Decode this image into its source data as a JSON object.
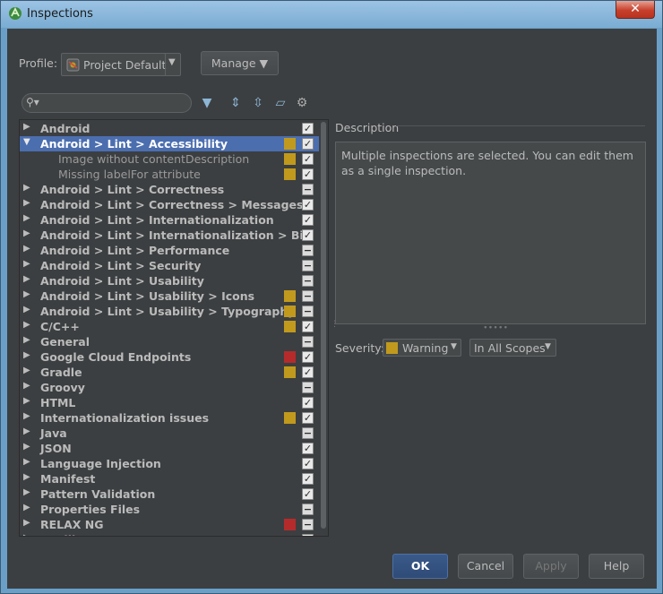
{
  "window": {
    "title": "Inspections",
    "close_glyph": "✕"
  },
  "profile": {
    "label": "Profile:",
    "value": "Project Default",
    "arrow": "▼"
  },
  "manage": {
    "label": "Manage ▼"
  },
  "search": {
    "icon": "search-icon",
    "placeholder": ""
  },
  "toolbar": {
    "filter": "filter-icon",
    "expand": "expand-all-icon",
    "collapse": "collapse-all-icon",
    "reset": "reset-icon",
    "settings": "gear-icon"
  },
  "colors": {
    "warning": "#c19a1d",
    "error": "#b52b2b",
    "selection": "#4b6eaf"
  },
  "tree": {
    "items": [
      {
        "label": "Android",
        "arrow": "▶",
        "severity": "",
        "check": "✓"
      },
      {
        "label": "Android > Lint > Accessibility",
        "arrow": "▼",
        "severity": "warning",
        "check": "✓",
        "selected": true
      },
      {
        "label": "Image without contentDescription",
        "arrow": "",
        "severity": "warning",
        "check": "✓",
        "child": true
      },
      {
        "label": "Missing labelFor attribute",
        "arrow": "",
        "severity": "warning",
        "check": "✓",
        "child": true
      },
      {
        "label": "Android > Lint > Correctness",
        "arrow": "▶",
        "severity": "",
        "check": "−"
      },
      {
        "label": "Android > Lint > Correctness > Messages",
        "arrow": "▶",
        "severity": "",
        "check": "✓"
      },
      {
        "label": "Android > Lint > Internationalization",
        "arrow": "▶",
        "severity": "",
        "check": "✓"
      },
      {
        "label": "Android > Lint > Internationalization > Bid",
        "arrow": "▶",
        "severity": "",
        "check": "✓"
      },
      {
        "label": "Android > Lint > Performance",
        "arrow": "▶",
        "severity": "",
        "check": "−"
      },
      {
        "label": "Android > Lint > Security",
        "arrow": "▶",
        "severity": "",
        "check": "−"
      },
      {
        "label": "Android > Lint > Usability",
        "arrow": "▶",
        "severity": "",
        "check": "−"
      },
      {
        "label": "Android > Lint > Usability > Icons",
        "arrow": "▶",
        "severity": "warning",
        "check": "−"
      },
      {
        "label": "Android > Lint > Usability > Typography",
        "arrow": "▶",
        "severity": "warning",
        "check": "−"
      },
      {
        "label": "C/C++",
        "arrow": "▶",
        "severity": "warning",
        "check": "✓"
      },
      {
        "label": "General",
        "arrow": "▶",
        "severity": "",
        "check": "−"
      },
      {
        "label": "Google Cloud Endpoints",
        "arrow": "▶",
        "severity": "error",
        "check": "✓"
      },
      {
        "label": "Gradle",
        "arrow": "▶",
        "severity": "warning",
        "check": "✓"
      },
      {
        "label": "Groovy",
        "arrow": "▶",
        "severity": "",
        "check": "−"
      },
      {
        "label": "HTML",
        "arrow": "▶",
        "severity": "",
        "check": "✓"
      },
      {
        "label": "Internationalization issues",
        "arrow": "▶",
        "severity": "warning",
        "check": "✓"
      },
      {
        "label": "Java",
        "arrow": "▶",
        "severity": "",
        "check": "−"
      },
      {
        "label": "JSON",
        "arrow": "▶",
        "severity": "",
        "check": "✓"
      },
      {
        "label": "Language Injection",
        "arrow": "▶",
        "severity": "",
        "check": "✓"
      },
      {
        "label": "Manifest",
        "arrow": "▶",
        "severity": "",
        "check": "✓"
      },
      {
        "label": "Pattern Validation",
        "arrow": "▶",
        "severity": "",
        "check": "✓"
      },
      {
        "label": "Properties Files",
        "arrow": "▶",
        "severity": "",
        "check": "−"
      },
      {
        "label": "RELAX NG",
        "arrow": "▶",
        "severity": "error",
        "check": "−"
      },
      {
        "label": "Spelling",
        "arrow": "▶",
        "severity": "",
        "check": "✓"
      }
    ]
  },
  "description": {
    "title": "Description",
    "text": "Multiple inspections are selected. You can edit them as a single inspection."
  },
  "severity": {
    "label": "Severity:",
    "value": "Warning",
    "scope": "In All Scopes",
    "arrow": "▼"
  },
  "buttons": {
    "ok": "OK",
    "cancel": "Cancel",
    "apply": "Apply",
    "help": "Help"
  }
}
